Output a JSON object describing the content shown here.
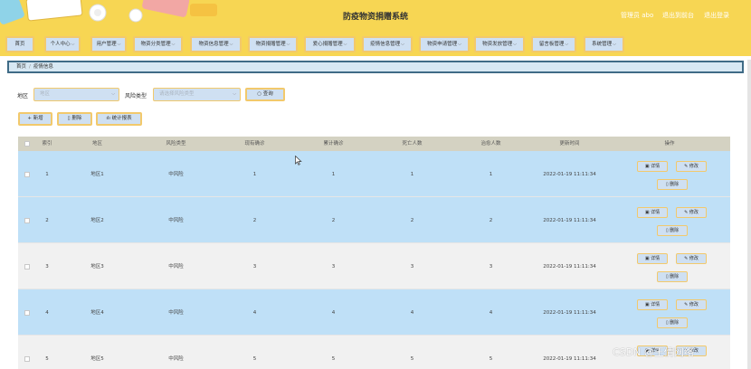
{
  "header": {
    "title": "防疫物资捐赠系统",
    "user": "管理员 abo",
    "back_to_front": "退出到前台",
    "logout": "退出登录"
  },
  "nav": [
    {
      "label": "首页",
      "dropdown": false
    },
    {
      "label": "个人中心",
      "dropdown": true
    },
    {
      "label": "用户管理",
      "dropdown": true
    },
    {
      "label": "物资分类管理",
      "dropdown": true
    },
    {
      "label": "物资信息管理",
      "dropdown": true
    },
    {
      "label": "物资捐赠管理",
      "dropdown": true
    },
    {
      "label": "爱心捐赠管理",
      "dropdown": true
    },
    {
      "label": "疫情信息管理",
      "dropdown": true
    },
    {
      "label": "物资申请管理",
      "dropdown": true
    },
    {
      "label": "物资发放管理",
      "dropdown": true
    },
    {
      "label": "留言板管理",
      "dropdown": true
    },
    {
      "label": "系统管理",
      "dropdown": true
    }
  ],
  "breadcrumb": {
    "home": "首页",
    "separator": "/",
    "current": "疫情信息"
  },
  "search": {
    "region_label": "地区",
    "region_placeholder": "地区",
    "risk_label": "风险类型",
    "risk_placeholder": "请选择风险类型",
    "query_button": "查询"
  },
  "actions": {
    "add": "新增",
    "delete": "删除",
    "stats": "统计报表"
  },
  "table": {
    "columns": [
      "索引",
      "地区",
      "风险类型",
      "现有确诊",
      "累计确诊",
      "死亡人数",
      "治愈人数",
      "更新时间",
      "操作"
    ],
    "rows": [
      {
        "index": "1",
        "region": "地区1",
        "risk": "中风险",
        "current": "1",
        "total": "1",
        "deaths": "1",
        "cured": "1",
        "updated": "2022-01-19 11:11:34"
      },
      {
        "index": "2",
        "region": "地区2",
        "risk": "中风险",
        "current": "2",
        "total": "2",
        "deaths": "2",
        "cured": "2",
        "updated": "2022-01-19 11:11:34"
      },
      {
        "index": "3",
        "region": "地区3",
        "risk": "中风险",
        "current": "3",
        "total": "3",
        "deaths": "3",
        "cured": "3",
        "updated": "2022-01-19 11:11:34"
      },
      {
        "index": "4",
        "region": "地区4",
        "risk": "中风险",
        "current": "4",
        "total": "4",
        "deaths": "4",
        "cured": "4",
        "updated": "2022-01-19 11:11:34"
      },
      {
        "index": "5",
        "region": "地区5",
        "risk": "中风险",
        "current": "5",
        "total": "5",
        "deaths": "5",
        "cured": "5",
        "updated": "2022-01-19 11:11:34"
      }
    ],
    "row_actions": {
      "detail": "详情",
      "edit": "修改",
      "delete": "删除"
    }
  },
  "watermark": "CSDN @王倩网络",
  "colors": {
    "header_bg": "#f7d653",
    "button_bg": "#cfe0f2",
    "button_border": "#f2c96c",
    "row_highlight": "#bfe0f7",
    "table_header": "#d4d2c2"
  }
}
